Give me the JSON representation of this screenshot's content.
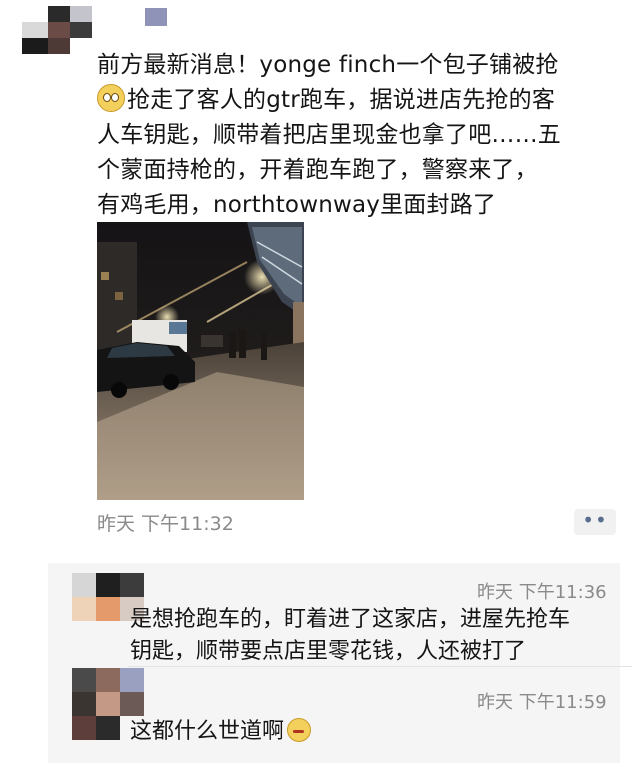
{
  "post": {
    "text_lines": [
      "前方最新消息！yonge finch一个包子铺被抢",
      "抢走了客人的gtr跑车，据说进店先抢的客",
      "人车钥匙，顺带着把店里现金也拿了吧……五",
      "个蒙面持枪的，开着跑车跑了，警察来了，",
      "有鸡毛用，northtownway里面封路了"
    ],
    "emoji": "dizzy-face-emoji",
    "timestamp": "昨天 下午11:32",
    "more_button": "••"
  },
  "comments": [
    {
      "time": "昨天 下午11:36",
      "lines": [
        "是想抢跑车的，盯着进了这家店，进屋先抢车",
        "钥匙，顺带要点店里零花钱，人还被打了"
      ]
    },
    {
      "time": "昨天 下午11:59",
      "lines": [
        "这都什么世道啊"
      ],
      "emoji": "awkward-face-emoji"
    }
  ],
  "colors": {
    "text": "#151515",
    "meta_gray": "#8a8a8a",
    "comment_bg": "#f5f5f5",
    "link_blue": "#5a6f90"
  }
}
